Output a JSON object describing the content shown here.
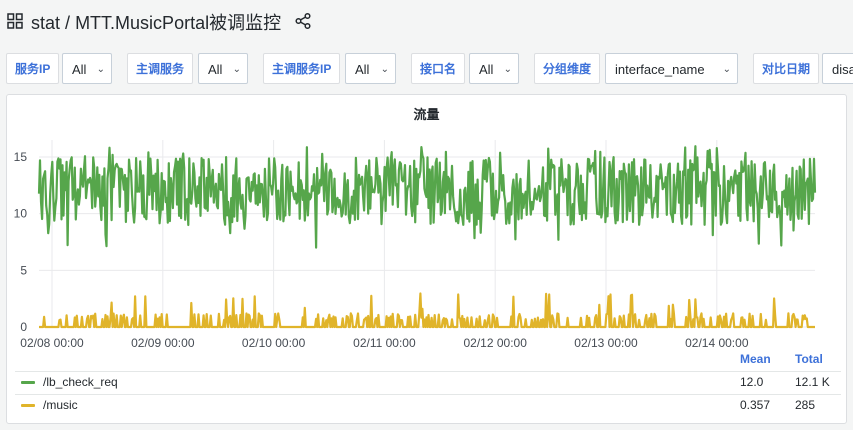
{
  "header": {
    "folder": "stat",
    "separator": "/",
    "dashboard": "MTT.MusicPortal被调监控"
  },
  "toolbar": {
    "variables": [
      {
        "label": "服务IP",
        "value": "All"
      },
      {
        "label": "主调服务",
        "value": "All"
      },
      {
        "label": "主调服务IP",
        "value": "All"
      },
      {
        "label": "接口名",
        "value": "All"
      },
      {
        "label": "分组维度",
        "value": "interface_name"
      },
      {
        "label": "对比日期",
        "value": "disa"
      }
    ]
  },
  "panel": {
    "title": "流量",
    "legend": {
      "columns": [
        "Mean",
        "Total"
      ],
      "rows": [
        {
          "name": "/lb_check_req",
          "mean": "12.0",
          "total": "12.1 K",
          "color": "#56a64b"
        },
        {
          "name": "/music",
          "mean": "0.357",
          "total": "285",
          "color": "#e0b42a"
        }
      ]
    }
  },
  "chart_data": {
    "type": "line",
    "x_tick_labels": [
      "02/08 00:00",
      "02/09 00:00",
      "02/10 00:00",
      "02/11 00:00",
      "02/12 00:00",
      "02/13 00:00",
      "02/14 00:00"
    ],
    "y_ticks": [
      0,
      5,
      10,
      15
    ],
    "ylim": [
      0,
      16.5
    ],
    "grid": true,
    "legend_position": "bottom",
    "series": [
      {
        "name": "/lb_check_req",
        "color": "#56a64b",
        "mean": 12.0,
        "typical_range": [
          9,
          15
        ],
        "peaks": [
          7,
          16
        ]
      },
      {
        "name": "/music",
        "color": "#e0b42a",
        "mean": 0.357,
        "typical_range": [
          0,
          1
        ],
        "peaks": [
          0,
          3
        ]
      }
    ]
  }
}
